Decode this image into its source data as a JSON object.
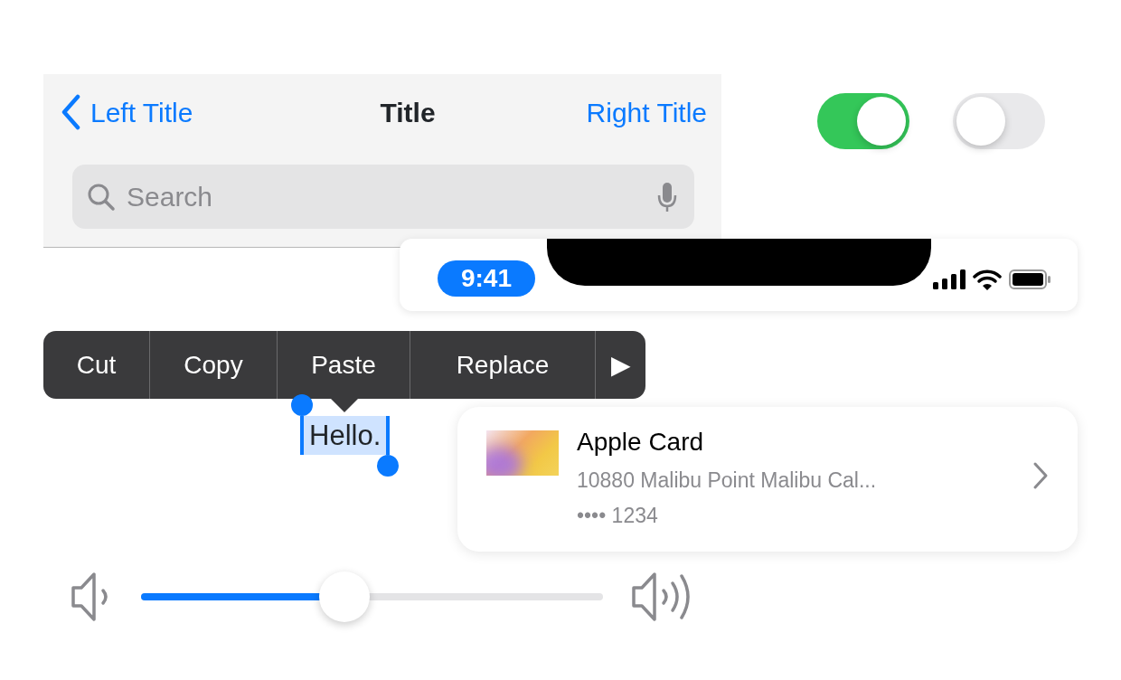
{
  "nav_bar": {
    "back_label": "Left Title",
    "title": "Title",
    "right_label": "Right Title",
    "search": {
      "placeholder": "Search"
    }
  },
  "toggles": [
    {
      "on": true
    },
    {
      "on": false
    }
  ],
  "status_bar": {
    "time": "9:41"
  },
  "edit_menu": {
    "items": [
      {
        "label": "Cut"
      },
      {
        "label": "Copy"
      },
      {
        "label": "Paste"
      },
      {
        "label": "Replace"
      },
      {
        "label": "▶"
      }
    ]
  },
  "selection": {
    "text": "Hello."
  },
  "payment_card": {
    "title": "Apple Card",
    "address": "10880 Malibu Point Malibu Cal...",
    "number": "•••• 1234"
  },
  "volume_slider": {
    "level": 0.44
  }
}
